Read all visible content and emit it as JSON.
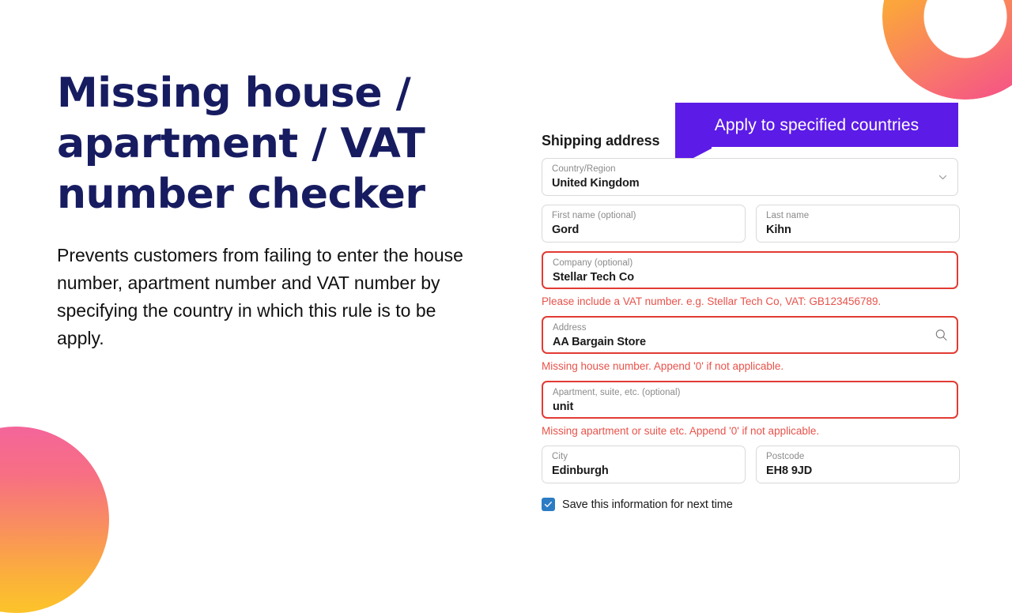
{
  "decor": {
    "ring_icon": "ring-shape",
    "circle_icon": "circle-shape",
    "gradient_start": "#fdc024",
    "gradient_end": "#f4468f"
  },
  "hero": {
    "headline": "Missing house / apartment / VAT number checker",
    "body": "Prevents customers from failing to enter the house number, apartment number and VAT number by specifying the country in which this rule is to be apply.",
    "headline_color": "#171c61"
  },
  "tooltip": {
    "label": "Apply to specified countries",
    "background": "#5c1be6",
    "text_color": "#ffffff"
  },
  "form": {
    "section_title": "Shipping address",
    "error_color": "#e8524a",
    "error_border_color": "#e23b33",
    "fields": {
      "country": {
        "label": "Country/Region",
        "value": "United Kingdom",
        "icon": "chevron-down-icon"
      },
      "first_name": {
        "label": "First name (optional)",
        "value": "Gord"
      },
      "last_name": {
        "label": "Last name",
        "value": "Kihn"
      },
      "company": {
        "label": "Company (optional)",
        "value": "Stellar Tech Co"
      },
      "address": {
        "label": "Address",
        "value": "AA Bargain Store",
        "icon": "search-icon"
      },
      "apartment": {
        "label": "Apartment, suite, etc. (optional)",
        "value": "unit"
      },
      "city": {
        "label": "City",
        "value": "Edinburgh"
      },
      "postcode": {
        "label": "Postcode",
        "value": "EH8 9JD"
      }
    },
    "errors": {
      "company": "Please include a VAT number. e.g. Stellar Tech Co, VAT: GB123456789.",
      "address": "Missing house number. Append '0' if not applicable.",
      "apartment": "Missing apartment or suite etc. Append '0' if not applicable."
    },
    "save": {
      "label": "Save this information for next time",
      "checked": true,
      "checkbox_color": "#2b7cc4"
    }
  }
}
